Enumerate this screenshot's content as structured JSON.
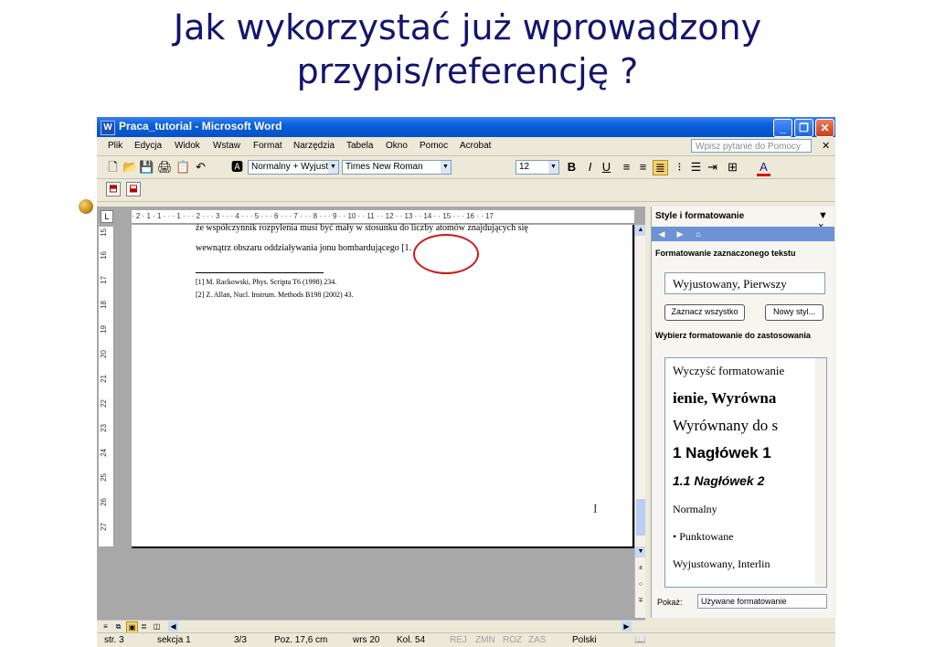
{
  "slide": {
    "title_line1": "Jak wykorzystać już wprowadzony",
    "title_line2": "przypis/referencję ?"
  },
  "window": {
    "title": "Praca_tutorial - Microsoft Word",
    "minimize": "_",
    "maximize": "❐",
    "close": "✕"
  },
  "menu": {
    "items": [
      "Plik",
      "Edycja",
      "Widok",
      "Wstaw",
      "Format",
      "Narzędzia",
      "Tabela",
      "Okno",
      "Pomoc",
      "Acrobat"
    ],
    "help_placeholder": "Wpisz pytanie do Pomocy",
    "close_doc": "✕"
  },
  "toolbar": {
    "style_value": "Normalny + Wyjust",
    "font_value": "Times New Roman",
    "size_value": "12",
    "bold": "B",
    "italic": "I",
    "underline": "U",
    "font_color_letter": "A"
  },
  "ruler": {
    "h_ticks": "· 2 · 1 · 1 · · · 1 · · · 2 · · · 3 · · · 4 · · · 5 · · · 6 · · · 7 · · · 8 · · · 9 · · 10 · · 11 · · 12 · · 13 · · 14 · · 15 · · · 16 · · 17",
    "v_ticks": [
      "15",
      "16",
      "17",
      "18",
      "19",
      "20",
      "21",
      "22",
      "23",
      "24",
      "25",
      "26",
      "27"
    ]
  },
  "document": {
    "line1": "że współczynnik rozpylenia musi być mały w stosunku do liczby atomów znajdujących się",
    "line2": "wewnątrz obszaru oddziaływania jonu bombardującego [1.",
    "footnote1": "[1] M. Rackowski, Phys. Scripta T6 (1998) 234.",
    "footnote2": "[2] Z. Allan, Nucl. Instrum. Methods B198 (2002) 43."
  },
  "pane": {
    "title": "Style i formatowanie",
    "close": "▼ ×",
    "section_selected": "Formatowanie zaznaczonego tekstu",
    "selected_value": "Wyjustowany, Pierwszy",
    "select_all_button": "Zaznacz wszystko",
    "new_style_button": "Nowy styl...",
    "section_apply": "Wybierz formatowanie do zastosowania",
    "styles": [
      "Wyczyść formatowanie",
      "ienie, Wyrówna",
      "Wyrównany do s",
      "1  Nagłówek 1",
      "1.1  Nagłówek 2",
      "Normalny",
      "•  Punktowane",
      "Wyjustowany, Interlin"
    ],
    "show_label": "Pokaż:",
    "show_value": "Używane formatowanie"
  },
  "status": {
    "page": "str. 3",
    "section": "sekcja 1",
    "pages": "3/3",
    "pos": "Poz. 17,6 cm",
    "line": "wrs 20",
    "col": "Kol. 54",
    "rec": "REJ",
    "zmn": "ZMN",
    "roz": "ROZ",
    "zas": "ZAS",
    "lang": "Polski"
  }
}
